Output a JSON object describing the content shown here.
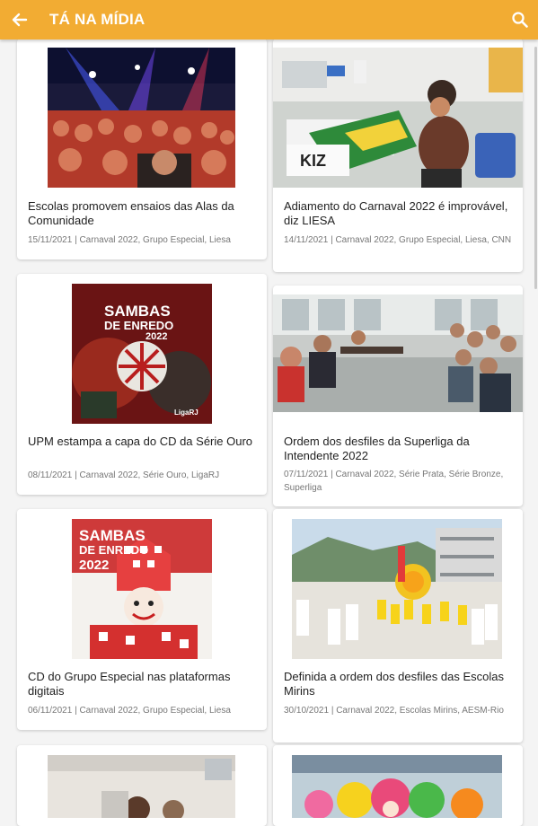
{
  "header": {
    "title": "TÁ NA MÍDIA",
    "back_icon": "arrow-left-icon",
    "search_icon": "search-icon",
    "bg_color": "#f2ac33"
  },
  "articles": [
    {
      "title": "Escolas promovem ensaios das Alas da Comunidade",
      "meta": "15/11/2021 | Carnaval 2022, Grupo Especial, Liesa"
    },
    {
      "title": "Adiamento do Carnaval 2022 é improvável, diz LIESA",
      "meta": "14/11/2021 | Carnaval 2022, Grupo Especial, Liesa, CNN"
    },
    {
      "title": "UPM estampa a capa do CD da Série Ouro",
      "meta": "08/11/2021 | Carnaval 2022, Série Ouro, LigaRJ"
    },
    {
      "title": "Ordem dos desfiles da Superliga da Intendente 2022",
      "meta": "07/11/2021 | Carnaval 2022, Série Prata, Série Bronze, Superliga"
    },
    {
      "title": "CD do Grupo Especial nas plataformas digitais",
      "meta": "06/11/2021 | Carnaval 2022, Grupo Especial, Liesa"
    },
    {
      "title": "Definida a ordem dos desfiles das Escolas Mirins",
      "meta": "30/10/2021 | Carnaval 2022, Escolas Mirins, AESM-Rio"
    }
  ],
  "covers": {
    "serie_ouro": {
      "line1": "SAMBAS",
      "line2": "DE ENREDO",
      "year": "2022",
      "logo": "LigaRJ"
    },
    "grupo_especial": {
      "line1": "SAMBAS",
      "line2": "DE ENREDO",
      "year": "2022"
    }
  }
}
